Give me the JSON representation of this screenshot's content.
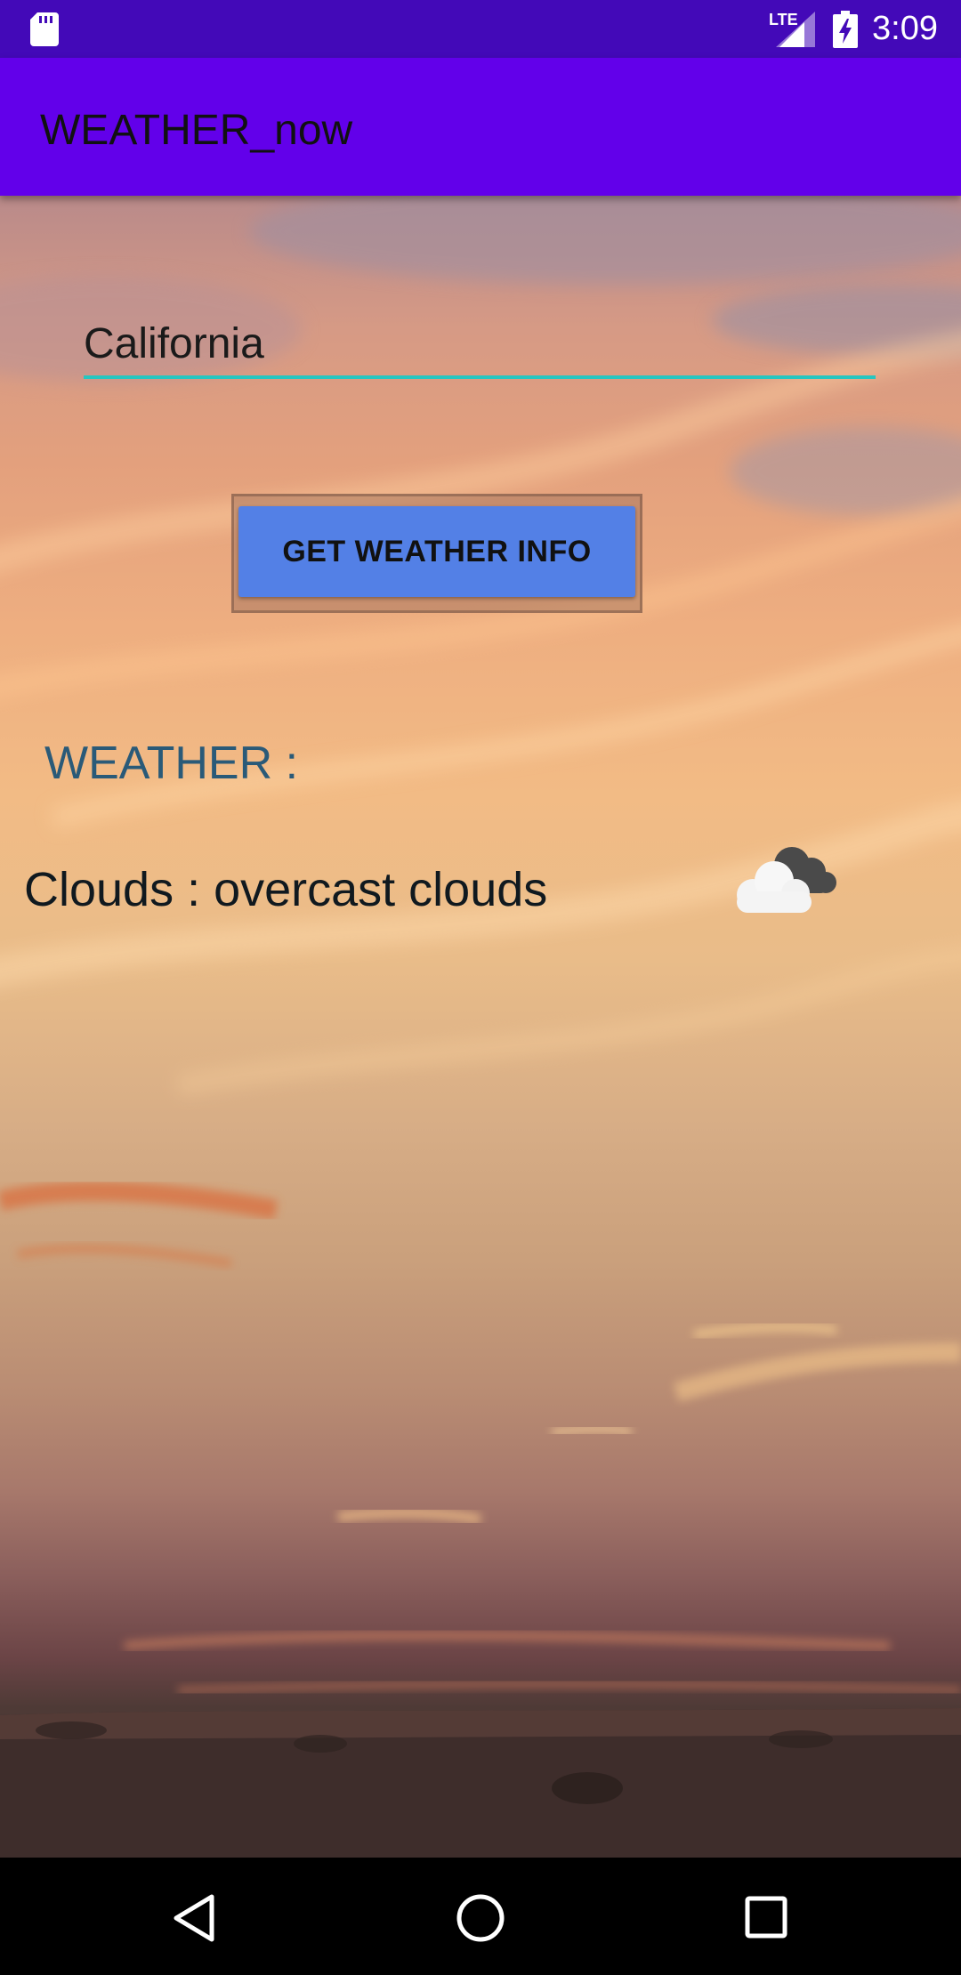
{
  "status_bar": {
    "network_label": "LTE",
    "time": "3:09"
  },
  "app_bar": {
    "title": "WEATHER_now"
  },
  "main": {
    "city_input_value": "California",
    "get_weather_button_label": "GET WEATHER INFO",
    "weather_label": "WEATHER :",
    "weather_result": "Clouds : overcast clouds",
    "weather_icon": "cloud-overcast-icon"
  },
  "nav_bar": {
    "icons": [
      "back-icon",
      "home-icon",
      "recents-icon"
    ]
  },
  "colors": {
    "status_bar": "#4309b8",
    "app_bar": "#6200ea",
    "input_underline": "#26c6c0",
    "button": "#5380e6",
    "weather_label": "#2a5a78"
  }
}
